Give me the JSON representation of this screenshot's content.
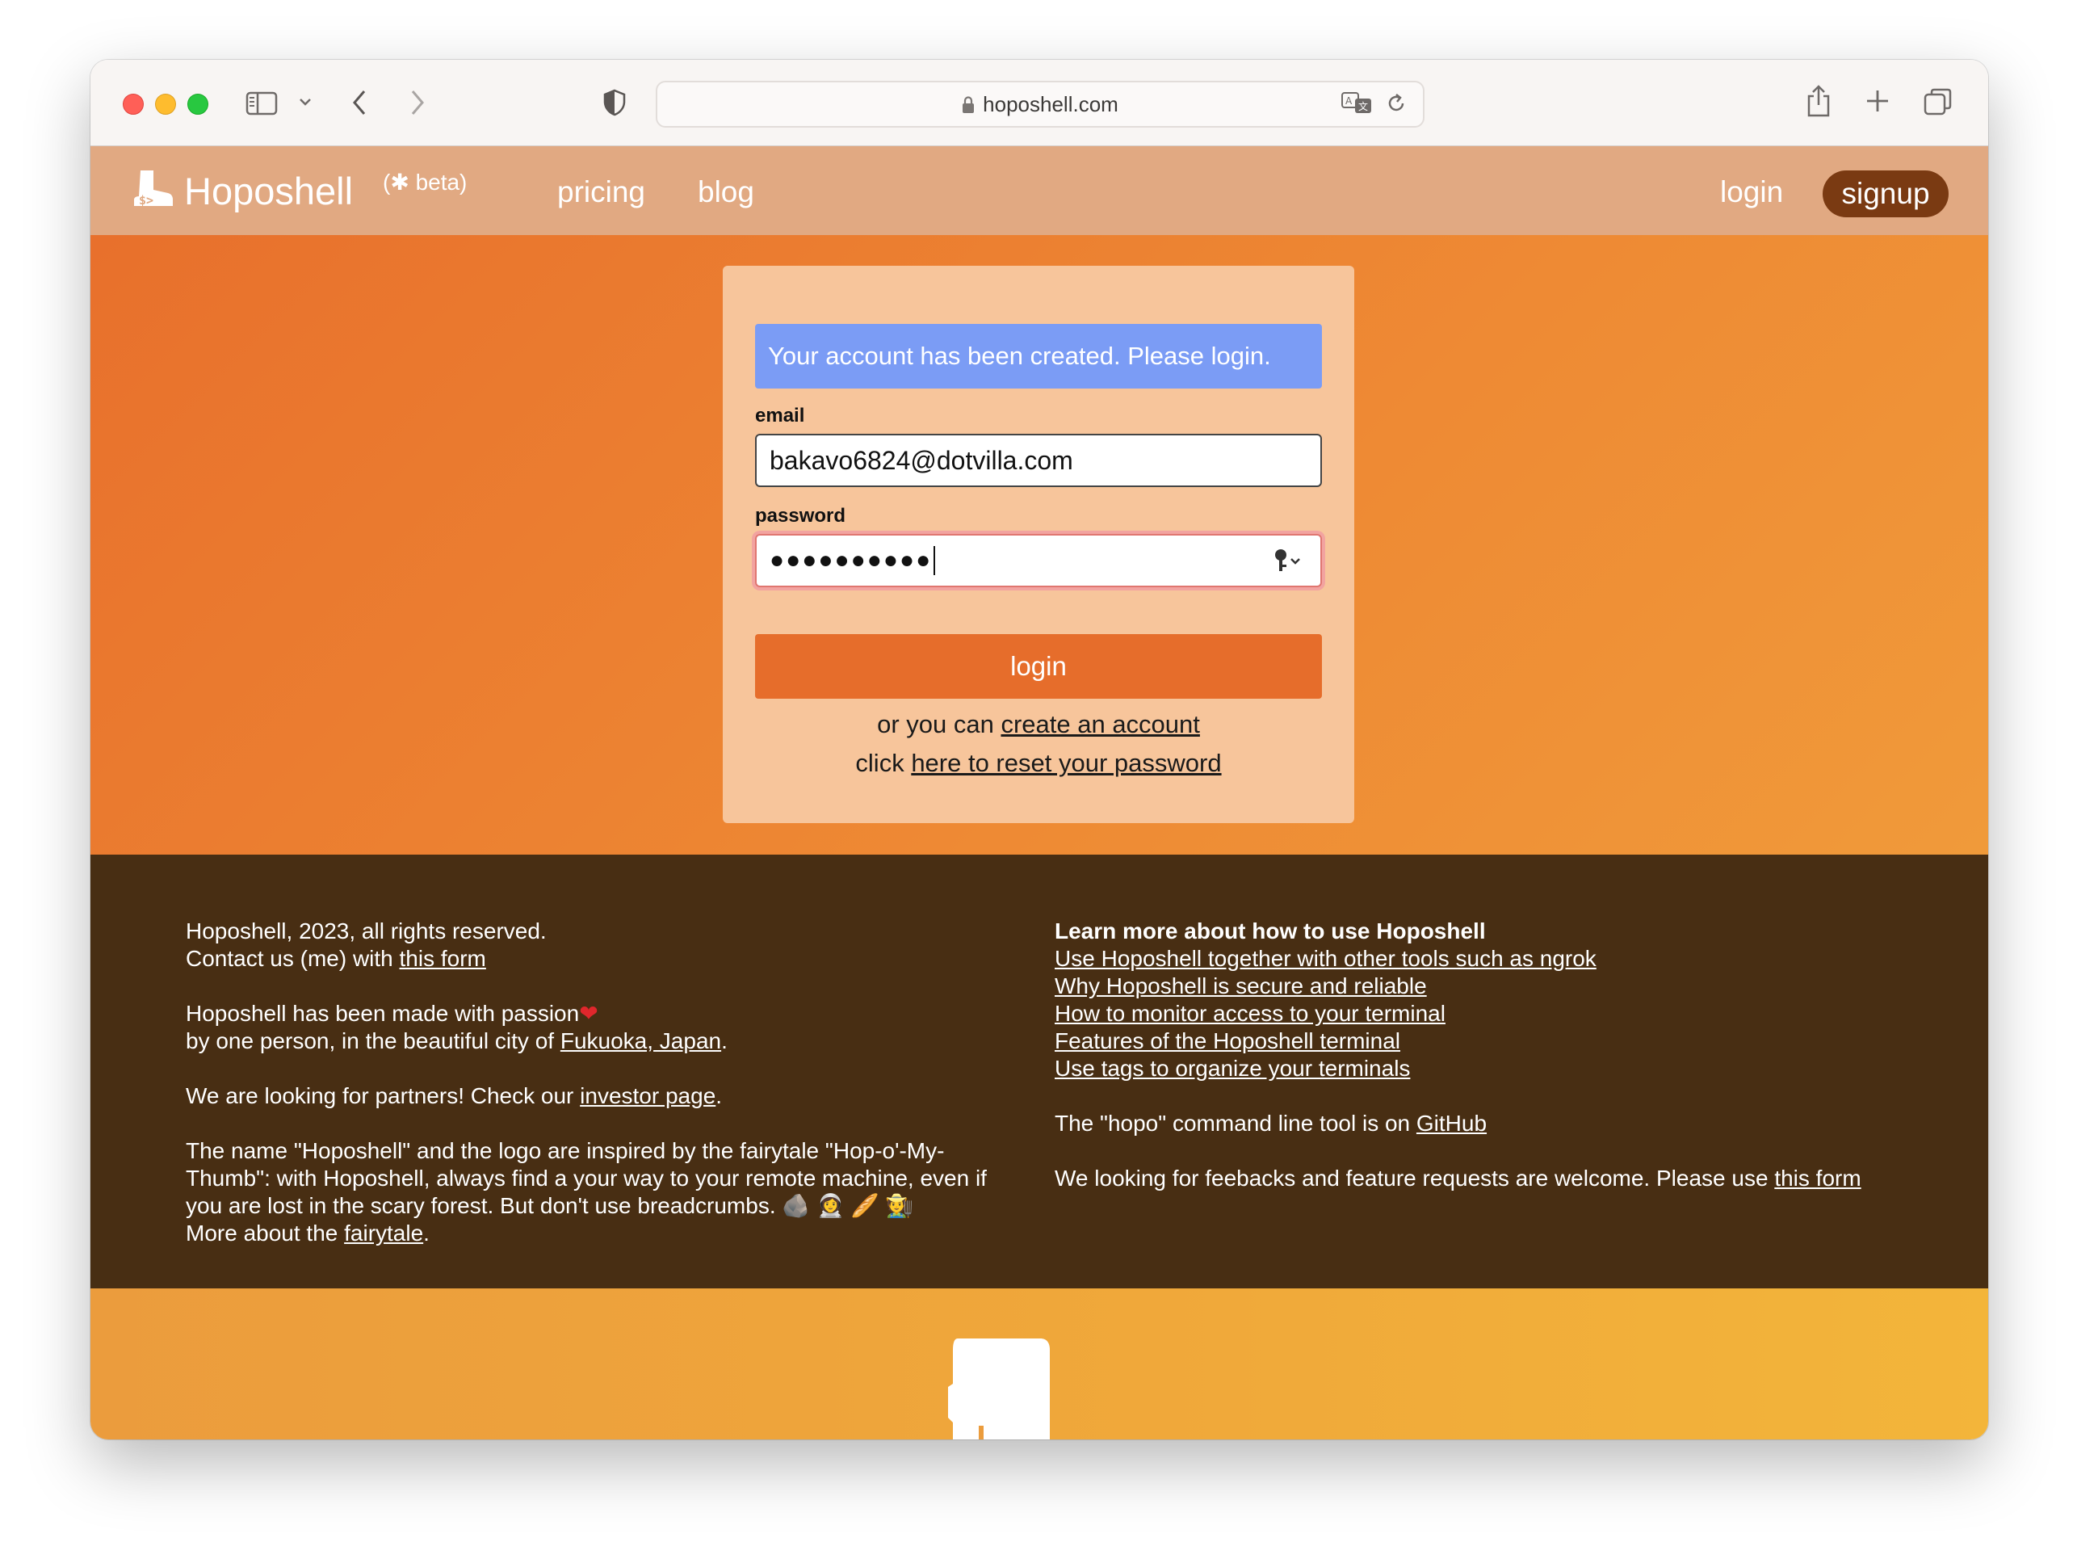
{
  "browser": {
    "url": "hoposhell.com"
  },
  "navbar": {
    "brand": "Hoposhell",
    "beta": "(✱ beta)",
    "pricing": "pricing",
    "blog": "blog",
    "login": "login",
    "signup": "signup"
  },
  "login_form": {
    "flash": "Your account has been created. Please login.",
    "email_label": "email",
    "email_value": "bakavo6824@dotvilla.com",
    "password_label": "password",
    "password_masked": "●●●●●●●●●●",
    "submit": "login",
    "create_prefix": "or you can ",
    "create_link": "create an account",
    "reset_prefix": "click ",
    "reset_link": "here to reset your password"
  },
  "footer": {
    "left": {
      "copyright": "Hoposhell, 2023, all rights reserved.",
      "contact_prefix": "Contact us (me) with ",
      "contact_link": "this form",
      "passion": "Hoposhell has been made with passion",
      "by_prefix": "by one person, in the beautiful city of ",
      "city_link": "Fukuoka, Japan",
      "partners_prefix": "We are looking for partners! Check our ",
      "investor_link": "investor page",
      "fairytale_text": "The name \"Hoposhell\" and the logo are inspired by the fairytale \"Hop-o'-My-Thumb\": with Hoposhell, always find a your way to your remote machine, even if you are lost in the scary forest. But don't use breadcrumbs.",
      "emojis": "🪨 👩‍🚀 🥖 🧑‍🌾",
      "more_prefix": "More about the ",
      "fairytale_link": "fairytale"
    },
    "right": {
      "heading": "Learn more about how to use Hoposhell",
      "links": [
        "Use Hoposhell together with other tools such as ngrok",
        "Why Hoposhell is secure and reliable",
        "How to monitor access to your terminal",
        "Features of the Hoposhell terminal",
        "Use tags to organize your terminals"
      ],
      "hopo_prefix": "The \"hopo\" command line tool is on ",
      "github_link": "GitHub",
      "feedback_prefix": "We looking for feebacks and feature requests are welcome. Please use ",
      "feedback_link": "this form"
    }
  },
  "colors": {
    "navbar": "#e1a982",
    "main_orange": "#e8702c",
    "card": "#f7c59b",
    "flash": "#7b9cf5",
    "login_button": "#e66d2b",
    "signup_button": "#7a3a12",
    "footer": "#482e13"
  }
}
